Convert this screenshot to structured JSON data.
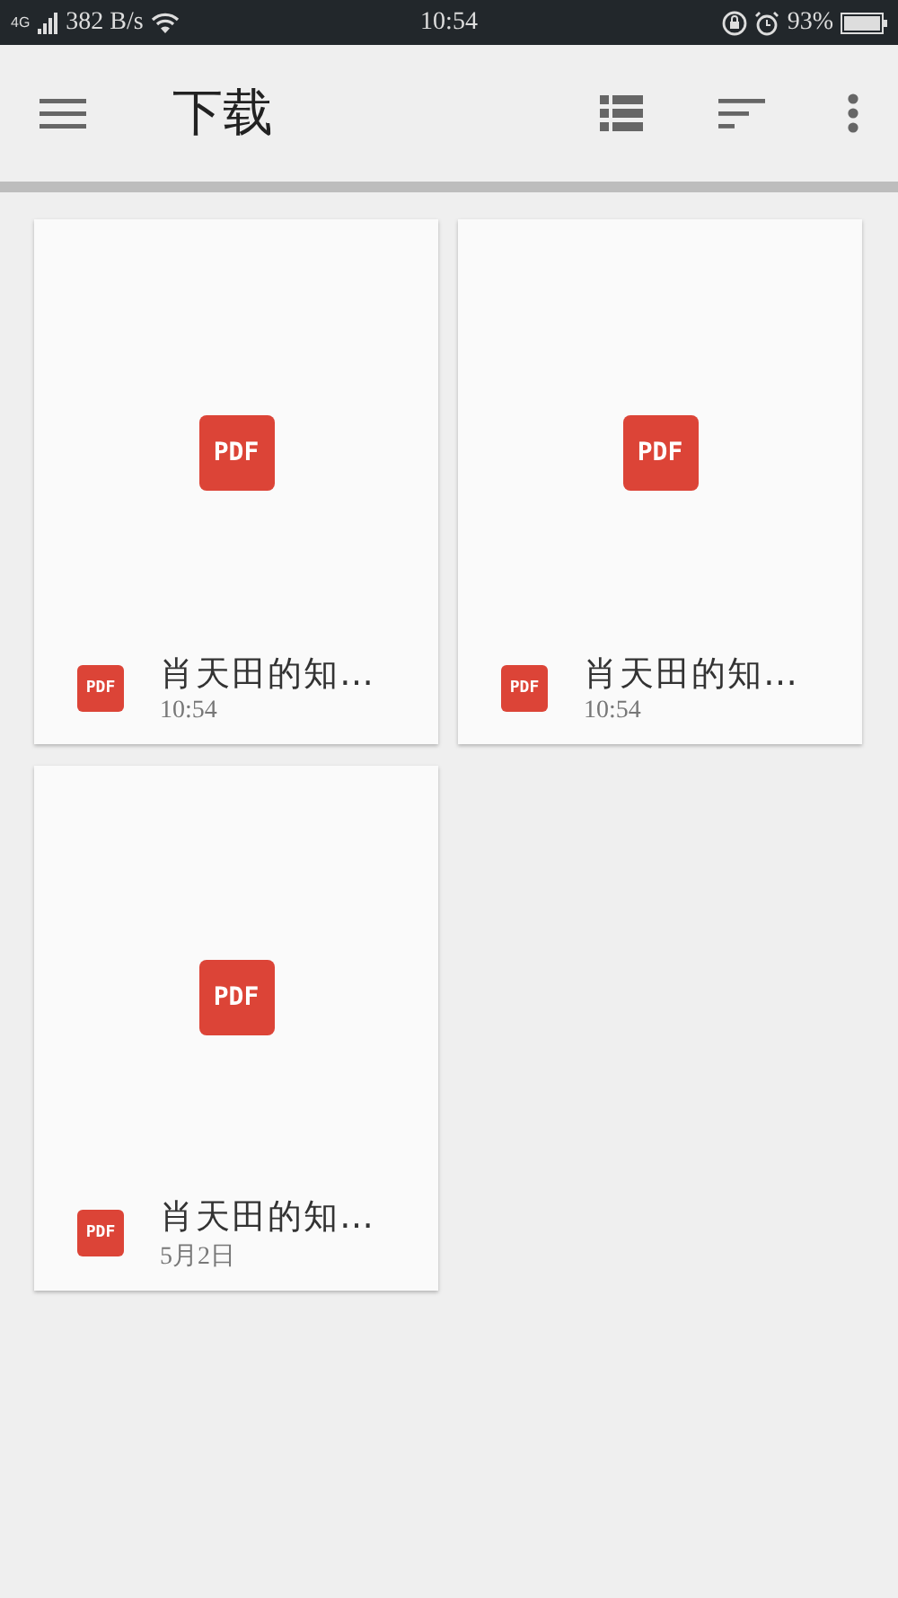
{
  "status_bar": {
    "network": "4G",
    "speed": "382 B/s",
    "time": "10:54",
    "battery": "93%"
  },
  "toolbar": {
    "title": "下载"
  },
  "files": [
    {
      "badge": "PDF",
      "type_label": "PDF",
      "name": "肖天田的知…",
      "date": "10:54"
    },
    {
      "badge": "PDF",
      "type_label": "PDF",
      "name": "肖天田的知…",
      "date": "10:54"
    },
    {
      "badge": "PDF",
      "type_label": "PDF",
      "name": "肖天田的知…",
      "date": "5月2日"
    }
  ]
}
